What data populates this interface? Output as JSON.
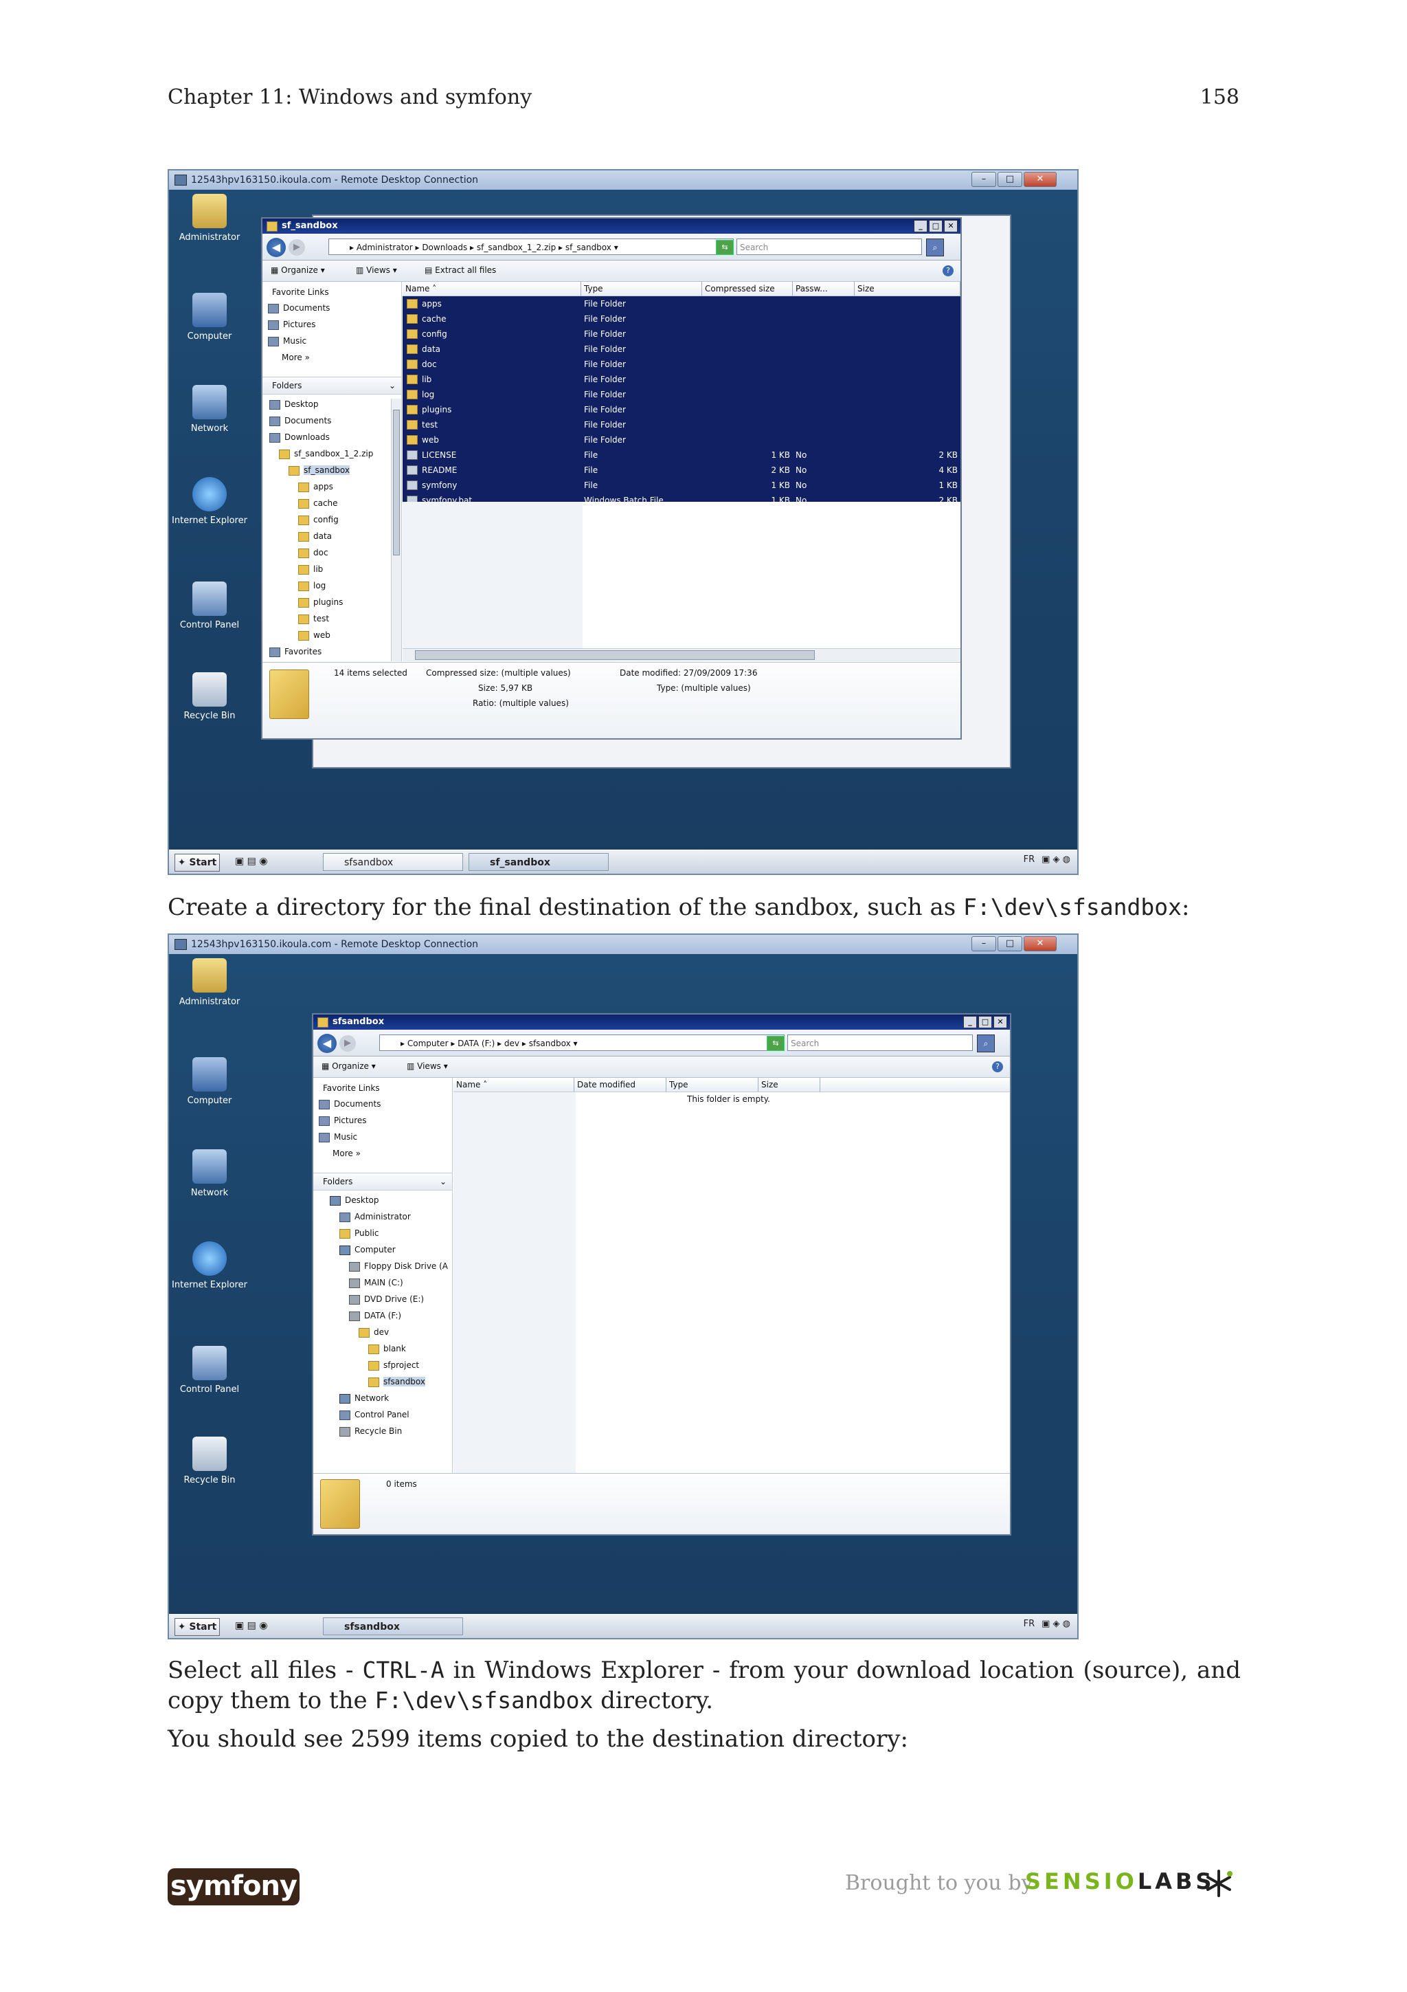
{
  "header": {
    "chapter": "Chapter 11: Windows and symfony",
    "page_number": "158"
  },
  "screenshot1": {
    "rdp_title": "12543hpv163150.ikoula.com - Remote Desktop Connection",
    "desktop_icons": [
      "Administrator",
      "Computer",
      "Network",
      "Internet Explorer",
      "Control Panel",
      "Recycle Bin"
    ],
    "window_title": "sf_sandbox",
    "address_parts": [
      "Administrator",
      "Downloads",
      "sf_sandbox_1_2.zip",
      "sf_sandbox"
    ],
    "search_placeholder": "Search",
    "toolbar": {
      "organize": "Organize",
      "views": "Views",
      "extract": "Extract all files"
    },
    "favorite_links_label": "Favorite Links",
    "favorite_links": [
      "Documents",
      "Pictures",
      "Music",
      "More"
    ],
    "folders_label": "Folders",
    "folder_tree": [
      "Desktop",
      "Documents",
      "Downloads",
      "sf_sandbox_1_2.zip",
      "sf_sandbox",
      "apps",
      "cache",
      "config",
      "data",
      "doc",
      "lib",
      "log",
      "plugins",
      "test",
      "web",
      "Favorites"
    ],
    "columns": [
      "Name",
      "Type",
      "Compressed size",
      "Passw...",
      "Size"
    ],
    "files": [
      {
        "name": "apps",
        "type": "File Folder",
        "csize": "",
        "pw": "",
        "size": ""
      },
      {
        "name": "cache",
        "type": "File Folder",
        "csize": "",
        "pw": "",
        "size": ""
      },
      {
        "name": "config",
        "type": "File Folder",
        "csize": "",
        "pw": "",
        "size": ""
      },
      {
        "name": "data",
        "type": "File Folder",
        "csize": "",
        "pw": "",
        "size": ""
      },
      {
        "name": "doc",
        "type": "File Folder",
        "csize": "",
        "pw": "",
        "size": ""
      },
      {
        "name": "lib",
        "type": "File Folder",
        "csize": "",
        "pw": "",
        "size": ""
      },
      {
        "name": "log",
        "type": "File Folder",
        "csize": "",
        "pw": "",
        "size": ""
      },
      {
        "name": "plugins",
        "type": "File Folder",
        "csize": "",
        "pw": "",
        "size": ""
      },
      {
        "name": "test",
        "type": "File Folder",
        "csize": "",
        "pw": "",
        "size": ""
      },
      {
        "name": "web",
        "type": "File Folder",
        "csize": "",
        "pw": "",
        "size": ""
      },
      {
        "name": "LICENSE",
        "type": "File",
        "csize": "1 KB",
        "pw": "No",
        "size": "2 KB"
      },
      {
        "name": "README",
        "type": "File",
        "csize": "2 KB",
        "pw": "No",
        "size": "4 KB"
      },
      {
        "name": "symfony",
        "type": "File",
        "csize": "1 KB",
        "pw": "No",
        "size": "1 KB"
      },
      {
        "name": "symfony.bat",
        "type": "Windows Batch File",
        "csize": "1 KB",
        "pw": "No",
        "size": "2 KB"
      }
    ],
    "details": {
      "selected": "14 items selected",
      "compressed": "Compressed size: (multiple values)",
      "size": "Size: 5,97 KB",
      "ratio": "Ratio: (multiple values)",
      "date": "Date modified: 27/09/2009 17:36",
      "type": "Type: (multiple values)"
    },
    "taskbar": {
      "start": "Start",
      "btn1": "sfsandbox",
      "btn2": "sf_sandbox",
      "lang": "FR"
    }
  },
  "paragraph1": {
    "text": "Create a directory for the final destination of the sandbox, such as ",
    "code": "F:\\dev\\sfsandbox",
    "tail": ":"
  },
  "screenshot2": {
    "rdp_title": "12543hpv163150.ikoula.com - Remote Desktop Connection",
    "window_title": "sfsandbox",
    "address_parts": [
      "Computer",
      "DATA (F:)",
      "dev",
      "sfsandbox"
    ],
    "search_placeholder": "Search",
    "toolbar": {
      "organize": "Organize",
      "views": "Views"
    },
    "favorite_links_label": "Favorite Links",
    "favorite_links": [
      "Documents",
      "Pictures",
      "Music",
      "More"
    ],
    "folders_label": "Folders",
    "folder_tree": [
      "Desktop",
      "Administrator",
      "Public",
      "Computer",
      "Floppy Disk Drive (A",
      "MAIN (C:)",
      "DVD Drive (E:)",
      "DATA (F:)",
      "dev",
      "blank",
      "sfproject",
      "sfsandbox",
      "Network",
      "Control Panel",
      "Recycle Bin"
    ],
    "columns": [
      "Name",
      "Date modified",
      "Type",
      "Size"
    ],
    "empty_msg": "This folder is empty.",
    "details_items": "0 items",
    "taskbar": {
      "start": "Start",
      "btn1": "sfsandbox",
      "lang": "FR"
    }
  },
  "paragraph2": {
    "a": "Select all files - ",
    "code1": "CTRL-A",
    "b": " in Windows Explorer - from your download location (source), and copy them to the ",
    "code2": "F:\\dev\\sfsandbox",
    "c": " directory."
  },
  "paragraph3": "You should see 2599 items copied to the destination directory:",
  "footer": {
    "logo": "symfony",
    "brought": "Brought to you by",
    "sensio": "SENSIO",
    "labs": "LABS"
  }
}
